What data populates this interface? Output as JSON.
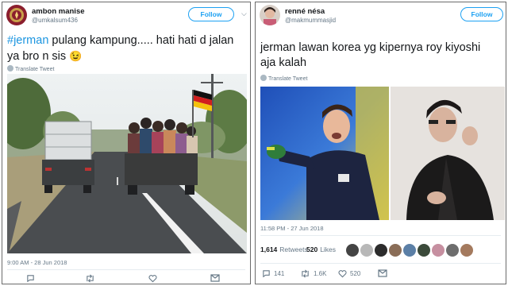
{
  "left_tweet": {
    "display_name": "ambon manise",
    "handle": "@umkalsum436",
    "follow_label": "Follow",
    "hashtag": "#jerman",
    "text_line1": " pulang kampung..... hati hati d jalan",
    "text_line2": "ya bro n sis",
    "emoji": "😉",
    "translate_label": "Translate Tweet",
    "timestamp": "9:00 AM - 28 Jun 2018",
    "actions": {
      "reply_icon": "reply-icon",
      "retweet_icon": "retweet-icon",
      "like_icon": "heart-icon",
      "dm_icon": "mail-icon"
    }
  },
  "right_tweet": {
    "display_name": "renné nésa",
    "handle": "@makmummasjid",
    "follow_label": "Follow",
    "text_line1": "jerman lawan korea yg kipernya roy kiyoshi",
    "text_line2": "aja kalah",
    "translate_label": "Translate Tweet",
    "timestamp": "11:58 PM - 27 Jun 2018",
    "retweets_count": "1,614",
    "retweets_label": "Retweets",
    "likes_count": "520",
    "likes_label": "Likes",
    "actions": {
      "reply_count": "141",
      "retweet_count": "1.6K",
      "like_count": "520"
    }
  },
  "colors": {
    "accent": "#1da1f2",
    "text": "#14171a",
    "muted": "#657786"
  }
}
